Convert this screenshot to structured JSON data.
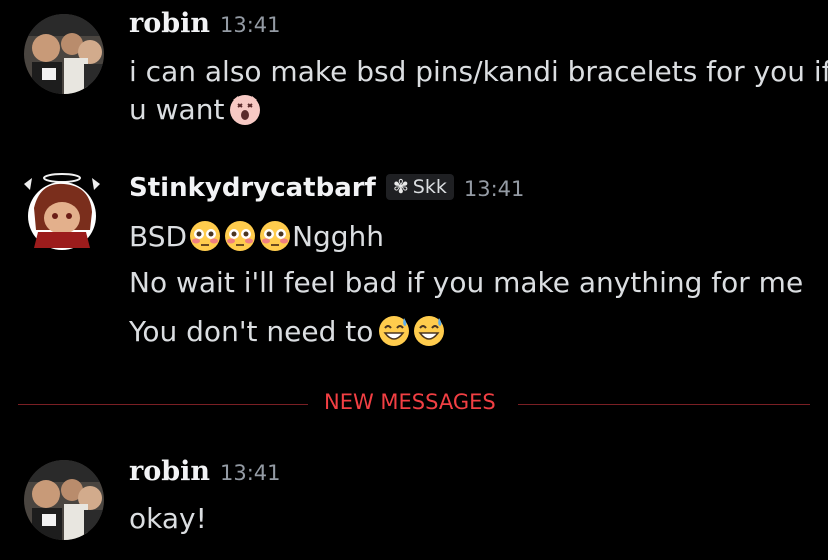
{
  "messages": [
    {
      "author": "robin",
      "time": "13:41",
      "lines": [
        "i can also make bsd pins/kandi bracelets for you if",
        "u want"
      ],
      "emoji": "scream-cat-emoji"
    },
    {
      "author": "Stinkydrycatbarf",
      "tag": "Skk",
      "time": "13:41",
      "lines": [
        "BSD",
        "Ngghh",
        "No wait i'll feel bad if you make anything for me",
        "You don't need to"
      ],
      "emoji": [
        "flushed-face-emoji",
        "grinning-sweat-emoji"
      ]
    },
    {
      "author": "robin",
      "time": "13:41",
      "lines": [
        "okay!"
      ]
    }
  ],
  "divider": {
    "label": "NEW MESSAGES",
    "color": "#f23f43"
  },
  "colors": {
    "background": "#000000",
    "text": "#dbdee1",
    "muted": "#949ba4"
  }
}
